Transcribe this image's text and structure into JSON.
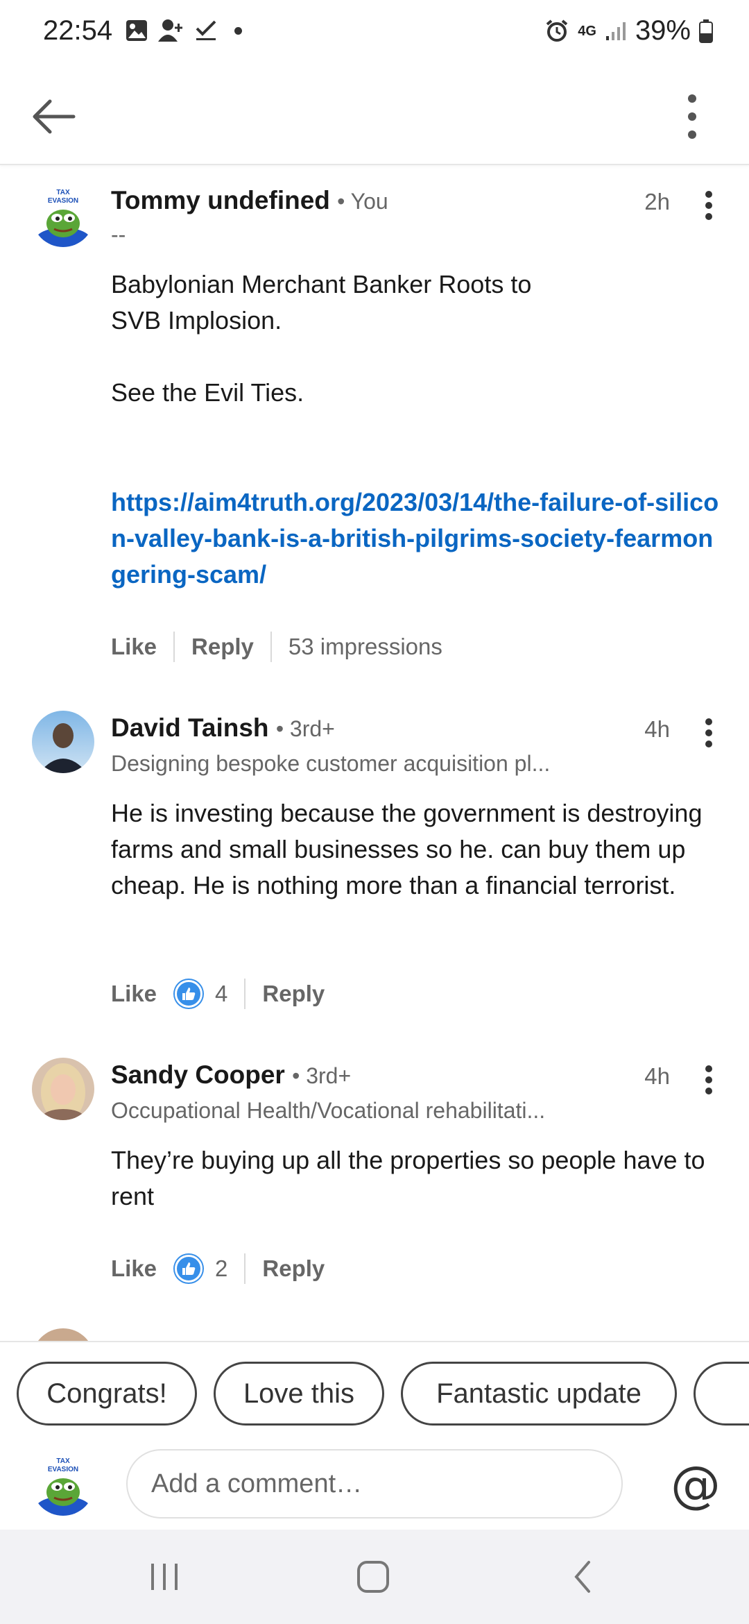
{
  "status_bar": {
    "time": "22:54",
    "network": "4G",
    "battery": "39%"
  },
  "comments": [
    {
      "name": "Tommy undefined",
      "degree": "• You",
      "time": "2h",
      "headline": "--",
      "body_lines": [
        "Babylonian Merchant Banker Roots to",
        "SVB Implosion.",
        "",
        "See the Evil Ties."
      ],
      "link": "https://aim4truth.org/2023/03/14/the-failure-of-silicon-valley-bank-is-a-british-pilgrims-society-fearmongering-scam/",
      "like_label": "Like",
      "reply_label": "Reply",
      "impressions": "53 impressions"
    },
    {
      "name": "David Tainsh",
      "degree": "• 3rd+",
      "time": "4h",
      "headline": "Designing bespoke customer acquisition pl...",
      "body": "He is investing because the government is destroying farms and small businesses so he. can buy them up cheap. He is nothing more than a financial terrorist.",
      "like_label": "Like",
      "reaction_count": "4",
      "reply_label": "Reply"
    },
    {
      "name": "Sandy Cooper",
      "degree": "• 3rd+",
      "time": "4h",
      "headline": "Occupational Health/Vocational rehabilitati...",
      "body": "They’re buying up all the properties so people have to rent",
      "like_label": "Like",
      "reaction_count": "2",
      "reply_label": "Reply"
    }
  ],
  "chips": [
    "Congrats!",
    "Love this",
    "Fantastic update"
  ],
  "composer": {
    "placeholder": "Add a comment…",
    "mention_symbol": "@"
  },
  "avatar_text": {
    "line1": "TAX",
    "line2": "EVASION"
  },
  "colors": {
    "link": "#0a66c2",
    "reaction": "#378fe9"
  }
}
